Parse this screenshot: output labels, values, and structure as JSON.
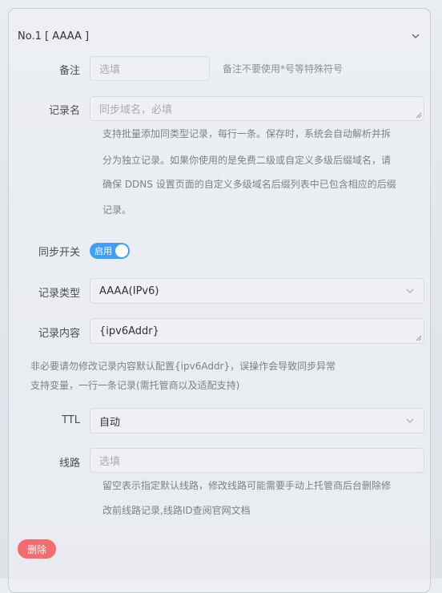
{
  "header": {
    "title": "No.1 [ AAAA ]"
  },
  "note": {
    "label": "备注",
    "placeholder": "选填",
    "hint": "备注不要使用*号等特殊符号"
  },
  "record_name": {
    "label": "记录名",
    "placeholder": "同步域名，必填",
    "help_lines": [
      "支持批量添加同类型记录，每行一条。保存时，系统会自动解析并拆",
      "分为独立记录。如果你使用的是免费二级或自定义多级后缀域名，请",
      "确保 DDNS 设置页面的自定义多级域名后缀列表中已包含相应的后缀",
      "记录。"
    ]
  },
  "sync_switch": {
    "label": "同步开关",
    "state_text": "启用"
  },
  "record_type": {
    "label": "记录类型",
    "value": "AAAA(IPv6)"
  },
  "record_content": {
    "label": "记录内容",
    "value": "{ipv6Addr}",
    "help_lines": [
      "非必要请勿修改记录内容默认配置{ipv6Addr}，误操作会导致同步异常",
      "支持变量，一行一条记录(需托管商以及适配支持)"
    ]
  },
  "ttl": {
    "label": "TTL",
    "value": "自动"
  },
  "line": {
    "label": "线路",
    "placeholder": "选填",
    "help_lines": [
      "留空表示指定默认线路，修改线路可能需要手动上托管商后台删除修",
      "改前线路记录,线路ID查阅官网文档"
    ]
  },
  "delete_button": {
    "label": "删除"
  },
  "colors": {
    "primary": "#409eff",
    "danger": "#f56c6c"
  },
  "icons": [
    "chevron-down-icon",
    "select-arrow-icon",
    "resize-handle-icon"
  ]
}
